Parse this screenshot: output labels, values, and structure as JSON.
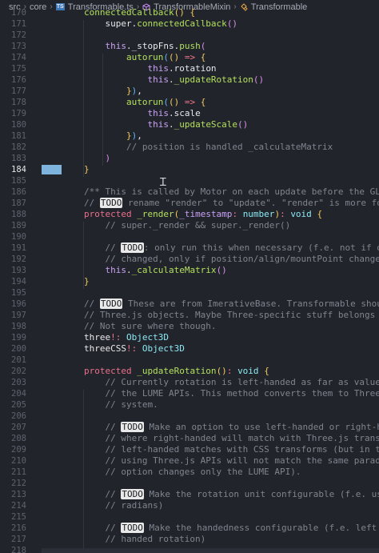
{
  "breadcrumb": {
    "items": [
      "src",
      "core",
      "Transformable.ts",
      "TransformableMixin",
      "Transformable"
    ],
    "ts_badge": "TS"
  },
  "editor": {
    "active_line": "184",
    "lines": [
      {
        "n": "170",
        "tokens": [
          [
            "fn",
            "        connectedCallback"
          ],
          [
            "bry",
            "()"
          ],
          [
            "pn",
            " "
          ],
          [
            "bry",
            "{"
          ]
        ]
      },
      {
        "n": "171",
        "tokens": [
          [
            "tx",
            "            super"
          ],
          [
            "pn",
            "."
          ],
          [
            "fn",
            "connectedCallback"
          ],
          [
            "brp",
            "()"
          ]
        ]
      },
      {
        "n": "172",
        "tokens": []
      },
      {
        "n": "173",
        "tokens": [
          [
            "th",
            "            this"
          ],
          [
            "pn",
            "."
          ],
          [
            "tx",
            "_stopFns"
          ],
          [
            "pn",
            "."
          ],
          [
            "fn",
            "push"
          ],
          [
            "brp",
            "("
          ]
        ]
      },
      {
        "n": "174",
        "tokens": [
          [
            "fn",
            "                autorun"
          ],
          [
            "brb",
            "("
          ],
          [
            "bry",
            "()"
          ],
          [
            "op",
            " => "
          ],
          [
            "bry",
            "{"
          ]
        ]
      },
      {
        "n": "175",
        "tokens": [
          [
            "th",
            "                    this"
          ],
          [
            "pn",
            "."
          ],
          [
            "tx",
            "rotation"
          ]
        ]
      },
      {
        "n": "176",
        "tokens": [
          [
            "th",
            "                    this"
          ],
          [
            "pn",
            "."
          ],
          [
            "fn",
            "_updateRotation"
          ],
          [
            "brp",
            "()"
          ]
        ]
      },
      {
        "n": "177",
        "tokens": [
          [
            "bry",
            "                }"
          ],
          [
            "brb",
            ")"
          ],
          [
            "pn",
            ","
          ]
        ]
      },
      {
        "n": "178",
        "tokens": [
          [
            "fn",
            "                autorun"
          ],
          [
            "brb",
            "("
          ],
          [
            "bry",
            "()"
          ],
          [
            "op",
            " => "
          ],
          [
            "bry",
            "{"
          ]
        ]
      },
      {
        "n": "179",
        "tokens": [
          [
            "th",
            "                    this"
          ],
          [
            "pn",
            "."
          ],
          [
            "tx",
            "scale"
          ]
        ]
      },
      {
        "n": "180",
        "tokens": [
          [
            "th",
            "                    this"
          ],
          [
            "pn",
            "."
          ],
          [
            "fn",
            "_updateScale"
          ],
          [
            "brp",
            "()"
          ]
        ]
      },
      {
        "n": "181",
        "tokens": [
          [
            "bry",
            "                }"
          ],
          [
            "brb",
            ")"
          ],
          [
            "pn",
            ","
          ]
        ]
      },
      {
        "n": "182",
        "tokens": [
          [
            "cm",
            "                // position is handled _calculateMatrix"
          ]
        ]
      },
      {
        "n": "183",
        "tokens": [
          [
            "brp",
            "            )"
          ]
        ]
      },
      {
        "n": "184",
        "tokens": [
          [
            "bry",
            "        }"
          ]
        ]
      },
      {
        "n": "185",
        "tokens": []
      },
      {
        "n": "186",
        "tokens": [
          [
            "cm",
            "        /** This is called by Motor on each update before the GL or"
          ]
        ]
      },
      {
        "n": "187",
        "tokens": [
          [
            "cm",
            "        // "
          ],
          [
            "todo",
            "TODO"
          ],
          [
            "cm",
            " rename \"render\" to \"update\". \"render\" is more fo"
          ]
        ]
      },
      {
        "n": "188",
        "tokens": [
          [
            "kw",
            "        protected "
          ],
          [
            "fn",
            "_render"
          ],
          [
            "bry",
            "("
          ],
          [
            "pr",
            "_timestamp"
          ],
          [
            "op",
            ": "
          ],
          [
            "ty",
            "number"
          ],
          [
            "bry",
            ")"
          ],
          [
            "op",
            ": "
          ],
          [
            "ty",
            "void"
          ],
          [
            "pn",
            " "
          ],
          [
            "bry",
            "{"
          ]
        ]
      },
      {
        "n": "189",
        "tokens": [
          [
            "cm",
            "            // super._render && super._render()"
          ]
        ]
      },
      {
        "n": "190",
        "tokens": []
      },
      {
        "n": "191",
        "tokens": [
          [
            "cm",
            "            // "
          ],
          [
            "todo",
            "TODO"
          ],
          [
            "cm",
            ": only run this when necessary (f.e. not if only"
          ]
        ]
      },
      {
        "n": "192",
        "tokens": [
          [
            "cm",
            "            // changed, only if position/align/mountPoint changed,"
          ]
        ]
      },
      {
        "n": "193",
        "tokens": [
          [
            "th",
            "            this"
          ],
          [
            "pn",
            "."
          ],
          [
            "fn",
            "_calculateMatrix"
          ],
          [
            "brp",
            "()"
          ]
        ]
      },
      {
        "n": "194",
        "tokens": [
          [
            "bry",
            "        }"
          ]
        ]
      },
      {
        "n": "195",
        "tokens": []
      },
      {
        "n": "196",
        "tokens": [
          [
            "cm",
            "        // "
          ],
          [
            "todo",
            "TODO"
          ],
          [
            "cm",
            " These are from ImerativeBase. Transformable shouldn"
          ]
        ]
      },
      {
        "n": "197",
        "tokens": [
          [
            "cm",
            "        // Three.js objects. Maybe Three-specific stuff belongs som"
          ]
        ]
      },
      {
        "n": "198",
        "tokens": [
          [
            "cm",
            "        // Not sure where though."
          ]
        ]
      },
      {
        "n": "199",
        "tokens": [
          [
            "tx",
            "        three"
          ],
          [
            "op",
            "!: "
          ],
          [
            "ty",
            "Object3D"
          ]
        ]
      },
      {
        "n": "200",
        "tokens": [
          [
            "tx",
            "        threeCSS"
          ],
          [
            "op",
            "!: "
          ],
          [
            "ty",
            "Object3D"
          ]
        ]
      },
      {
        "n": "201",
        "tokens": []
      },
      {
        "n": "202",
        "tokens": [
          [
            "kw",
            "        protected "
          ],
          [
            "fn",
            "_updateRotation"
          ],
          [
            "bry",
            "()"
          ],
          [
            "op",
            ": "
          ],
          [
            "ty",
            "void"
          ],
          [
            "pn",
            " "
          ],
          [
            "bry",
            "{"
          ]
        ]
      },
      {
        "n": "203",
        "tokens": [
          [
            "cm",
            "            // Currently rotation is left-handed as far as values i"
          ]
        ]
      },
      {
        "n": "204",
        "tokens": [
          [
            "cm",
            "            // the LUME APIs. This method converts them to Three's"
          ]
        ]
      },
      {
        "n": "205",
        "tokens": [
          [
            "cm",
            "            // system."
          ]
        ]
      },
      {
        "n": "206",
        "tokens": []
      },
      {
        "n": "207",
        "tokens": [
          [
            "cm",
            "            // "
          ],
          [
            "todo",
            "TODO"
          ],
          [
            "cm",
            " Make an option to use left-handed or right-han"
          ]
        ]
      },
      {
        "n": "208",
        "tokens": [
          [
            "cm",
            "            // where right-handed will match with Three.js transfor"
          ]
        ]
      },
      {
        "n": "209",
        "tokens": [
          [
            "cm",
            "            // left-handed matches with CSS transforms (but in the"
          ]
        ]
      },
      {
        "n": "210",
        "tokens": [
          [
            "cm",
            "            // using Three.js APIs will not match the same paradigm"
          ]
        ]
      },
      {
        "n": "211",
        "tokens": [
          [
            "cm",
            "            // option changes only the LUME API)."
          ]
        ]
      },
      {
        "n": "212",
        "tokens": []
      },
      {
        "n": "213",
        "tokens": [
          [
            "cm",
            "            // "
          ],
          [
            "todo",
            "TODO"
          ],
          [
            "cm",
            " Make the rotation unit configurable (f.e. use d"
          ]
        ]
      },
      {
        "n": "214",
        "tokens": [
          [
            "cm",
            "            // radians)"
          ]
        ]
      },
      {
        "n": "215",
        "tokens": []
      },
      {
        "n": "216",
        "tokens": [
          [
            "cm",
            "            // "
          ],
          [
            "todo",
            "TODO"
          ],
          [
            "cm",
            " Make the handedness configurable (f.e. left han"
          ]
        ]
      },
      {
        "n": "217",
        "tokens": [
          [
            "cm",
            "            // handed rotation)"
          ]
        ]
      },
      {
        "n": "218",
        "tokens": []
      }
    ]
  }
}
